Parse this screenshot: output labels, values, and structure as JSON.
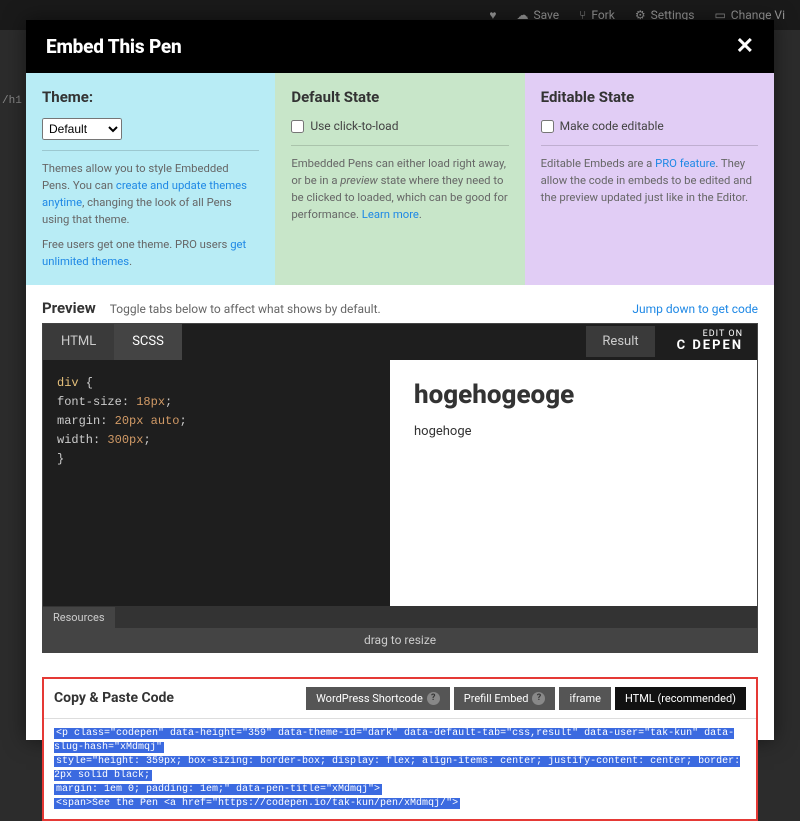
{
  "toolbar": {
    "save": "Save",
    "fork": "Fork",
    "settings": "Settings",
    "change_view": "Change Vi"
  },
  "modal": {
    "title": "Embed This Pen"
  },
  "side_text": "/h1",
  "theme_panel": {
    "heading": "Theme:",
    "select_value": "Default",
    "desc1_a": "Themes allow you to style Embedded Pens. You can ",
    "desc1_link": "create and update themes anytime",
    "desc1_b": ", changing the look of all Pens using that theme.",
    "desc2_a": "Free users get one theme. PRO users ",
    "desc2_link": "get unlimited themes",
    "desc2_b": "."
  },
  "default_panel": {
    "heading": "Default State",
    "checkbox_label": "Use click-to-load",
    "desc_a": "Embedded Pens can either load right away, or be in a ",
    "desc_i": "preview",
    "desc_b": " state where they need to be clicked to loaded, which can be good for performance. ",
    "desc_link": "Learn more",
    "desc_c": "."
  },
  "editable_panel": {
    "heading": "Editable State",
    "checkbox_label": "Make code editable",
    "desc_a": "Editable Embeds are a ",
    "desc_link": "PRO feature",
    "desc_b": ". They allow the code in embeds to be edited and the preview updated just like in the Editor."
  },
  "preview": {
    "title": "Preview",
    "hint": "Toggle tabs below to affect what shows by default.",
    "jump_link": "Jump down to get code"
  },
  "embed": {
    "tab_html": "HTML",
    "tab_scss": "SCSS",
    "result_btn": "Result",
    "edit_on": "EDIT ON",
    "codepen": "C   DEPEN",
    "resources": "Resources",
    "drag": "drag to resize",
    "css_code": {
      "l1a": "div",
      "l1b": " {",
      "l2a": "  font-size",
      "l2b": ": ",
      "l2c": "18px",
      "l2d": ";",
      "l3a": "  margin",
      "l3b": ": ",
      "l3c": "20px",
      "l3d": " ",
      "l3e": "auto",
      "l3f": ";",
      "l4a": "  width",
      "l4b": ": ",
      "l4c": "300px",
      "l4d": ";",
      "l5": "}"
    },
    "result_content": {
      "h1": "hogehogeoge",
      "p": "hogehoge"
    }
  },
  "copy": {
    "title": "Copy & Paste Code",
    "tab_wp": "WordPress Shortcode",
    "tab_prefill": "Prefill Embed",
    "tab_iframe": "iframe",
    "tab_html": "HTML (recommended)",
    "q": "?",
    "code_line1": "<p class=\"codepen\" data-height=\"359\" data-theme-id=\"dark\" data-default-tab=\"css,result\" data-user=\"tak-kun\" data-slug-hash=\"xMdmqj\"",
    "code_line2": "style=\"height: 359px; box-sizing: border-box; display: flex; align-items: center; justify-content: center; border: 2px solid black;",
    "code_line3": "margin: 1em 0; padding: 1em;\" data-pen-title=\"xMdmqj\">",
    "code_line4": "  <span>See the Pen <a href=\"https://codepen.io/tak-kun/pen/xMdmqj/\">"
  }
}
